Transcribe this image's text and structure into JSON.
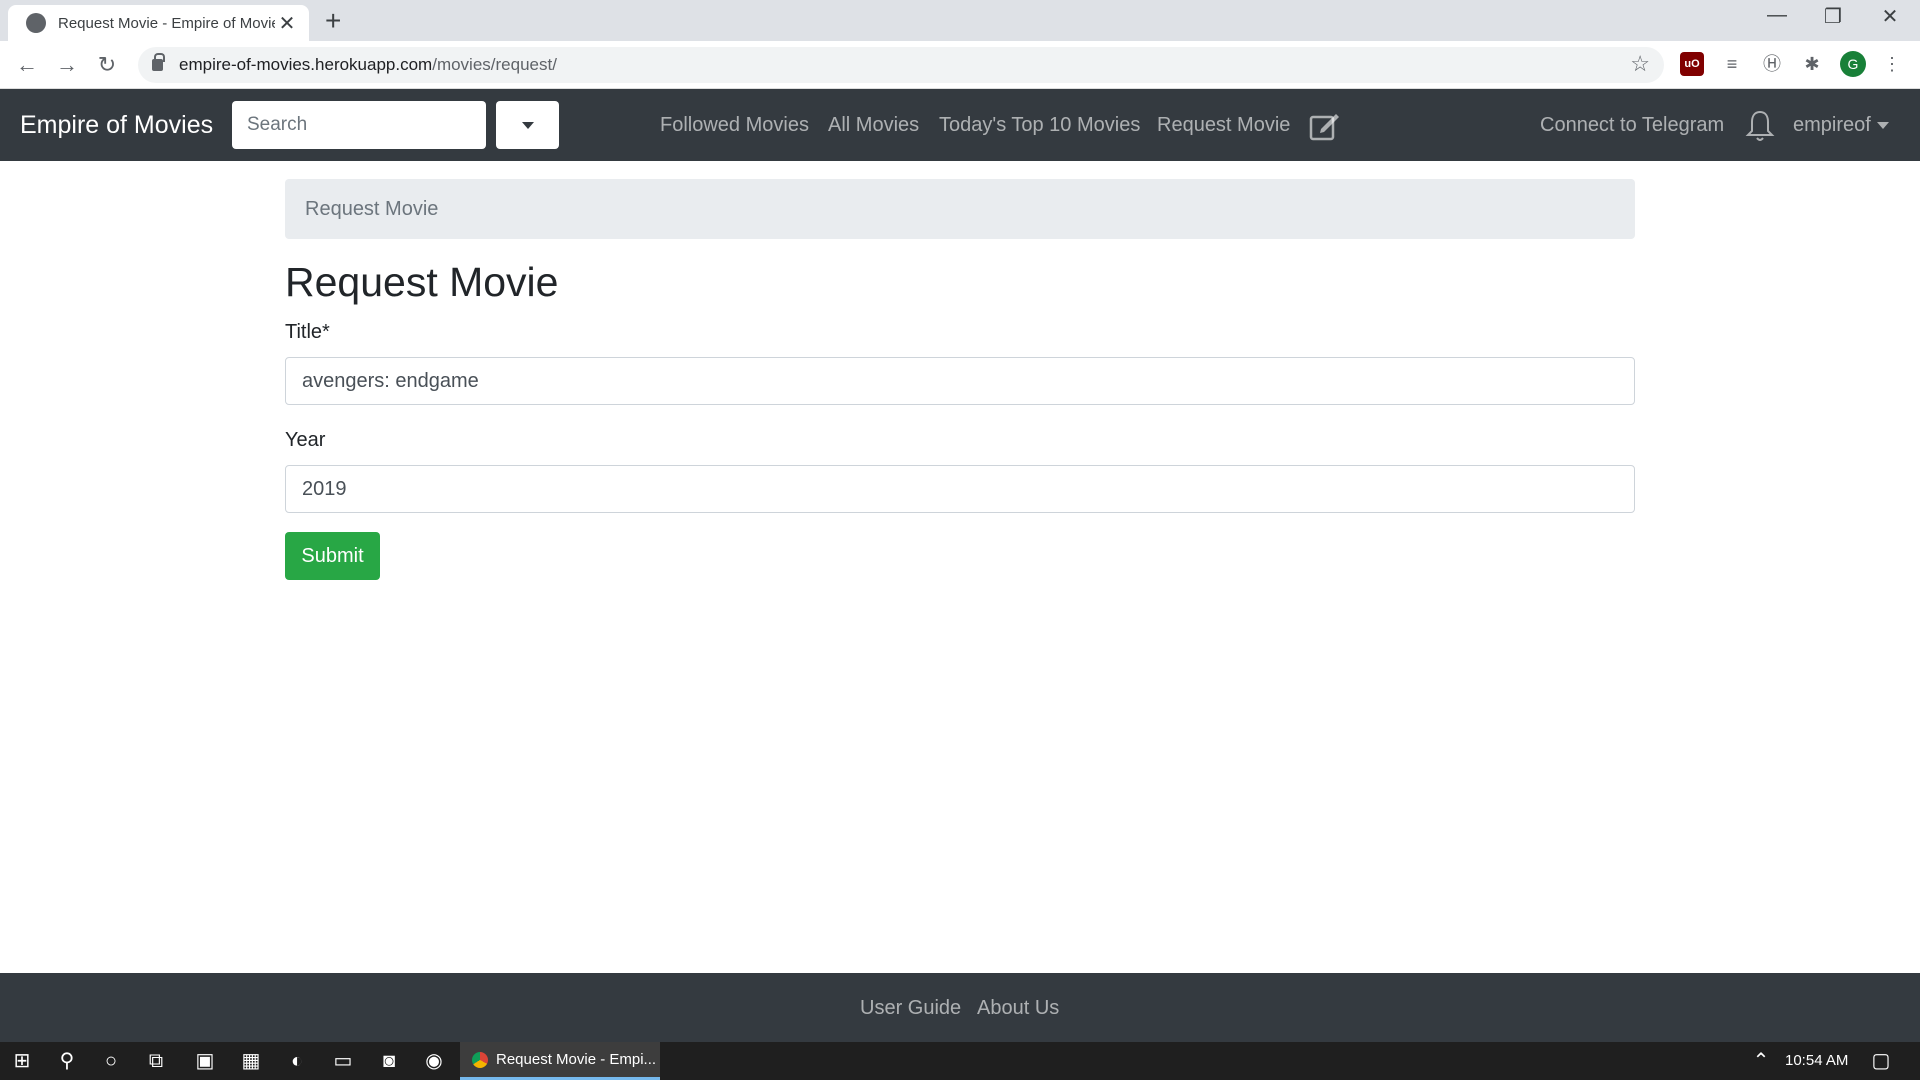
{
  "browser": {
    "tab_title": "Request Movie - Empire of Movie",
    "url_host": "empire-of-movies.herokuapp.com",
    "url_path": "/movies/request/",
    "profile_initial": "G"
  },
  "navbar": {
    "brand": "Empire of Movies",
    "search_placeholder": "Search",
    "links": {
      "followed": "Followed Movies",
      "all": "All Movies",
      "top10": "Today's Top 10 Movies",
      "request": "Request Movie",
      "telegram": "Connect to Telegram",
      "user": "empireof"
    }
  },
  "breadcrumb": {
    "current": "Request Movie"
  },
  "form": {
    "heading": "Request Movie",
    "title_label": "Title*",
    "title_value": "avengers: endgame",
    "year_label": "Year",
    "year_value": "2019",
    "submit_label": "Submit"
  },
  "footer": {
    "user_guide": "User Guide",
    "about_us": "About Us"
  },
  "taskbar": {
    "active_window": "Request Movie - Empi...",
    "clock": "10:54 AM"
  },
  "colors": {
    "navbar_bg": "#343a40",
    "submit_bg": "#28a745",
    "breadcrumb_bg": "#e9ecef"
  }
}
